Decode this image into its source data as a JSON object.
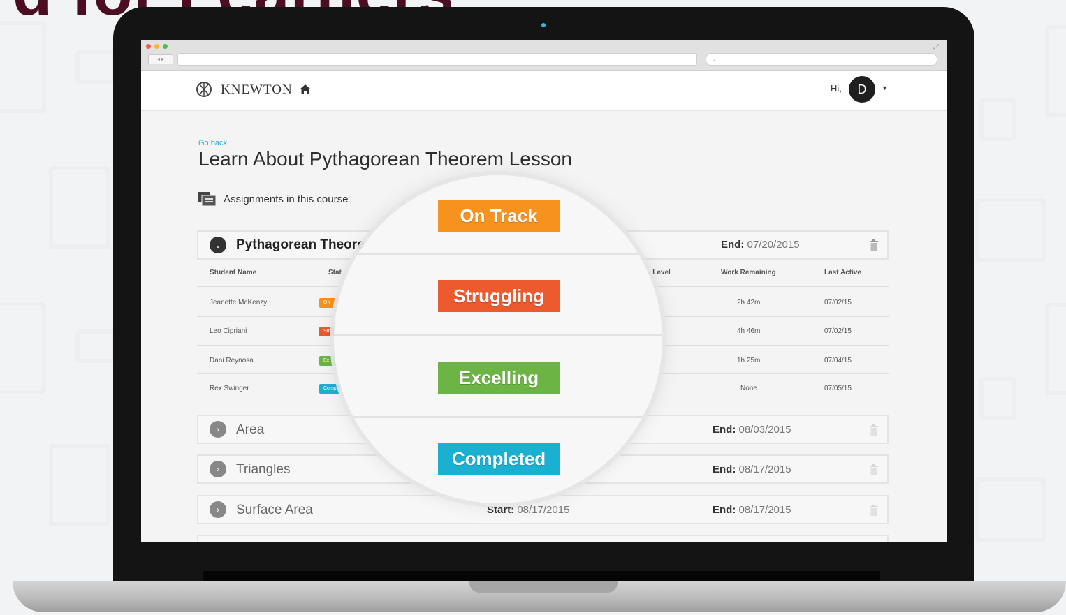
{
  "heading": "d for Learners",
  "browser": {
    "back_forward": "◂ ▸",
    "url_glyph": "·",
    "search_glyph": "⌕"
  },
  "header": {
    "logo": "KNEWTON",
    "greeting": "Hi,",
    "avatar_initial": "D"
  },
  "page": {
    "go_back": "Go back",
    "title": "Learn About Pythagorean Theorem Lesson",
    "assignments_label": "Assignments in this course"
  },
  "assignments": [
    {
      "title": "Pythagorean Theorem",
      "start_label": "",
      "start_date": "",
      "end_label": "End:",
      "end_date": "07/20/2015",
      "expanded": true
    },
    {
      "title": "Area",
      "start_label": "",
      "start_date": "",
      "end_label": "End:",
      "end_date": "08/03/2015",
      "expanded": false
    },
    {
      "title": "Triangles",
      "start_label": "",
      "start_date": "",
      "end_label": "End:",
      "end_date": "08/17/2015",
      "expanded": false
    },
    {
      "title": "Surface Area",
      "start_label": "Start:",
      "start_date": "08/17/2015",
      "end_label": "End:",
      "end_date": "08/17/2015",
      "expanded": false
    }
  ],
  "table": {
    "columns": [
      "Student Name",
      "Stat",
      "ry Level",
      "Work Remaining",
      "Last Active"
    ],
    "rows": [
      {
        "name": "Jeanette McKenzy",
        "status": "On",
        "work": "2h 42m",
        "last_active": "07/02/15"
      },
      {
        "name": "Leo Cipriani",
        "status": "Str",
        "work": "4h 46m",
        "last_active": "07/02/15"
      },
      {
        "name": "Dani Reynosa",
        "status": "Ex",
        "work": "1h 25m",
        "last_active": "07/04/15"
      },
      {
        "name": "Rex Swinger",
        "status": "Comp",
        "work": "None",
        "last_active": "07/05/15"
      }
    ]
  },
  "status_badges": [
    {
      "label": "On Track",
      "color": "#f7921e"
    },
    {
      "label": "Struggling",
      "color": "#ec5a2d"
    },
    {
      "label": "Excelling",
      "color": "#6cb544"
    },
    {
      "label": "Completed",
      "color": "#1ab0d2"
    }
  ],
  "colors": {
    "accent": "#29a8d8",
    "heading": "#4b0d22"
  }
}
